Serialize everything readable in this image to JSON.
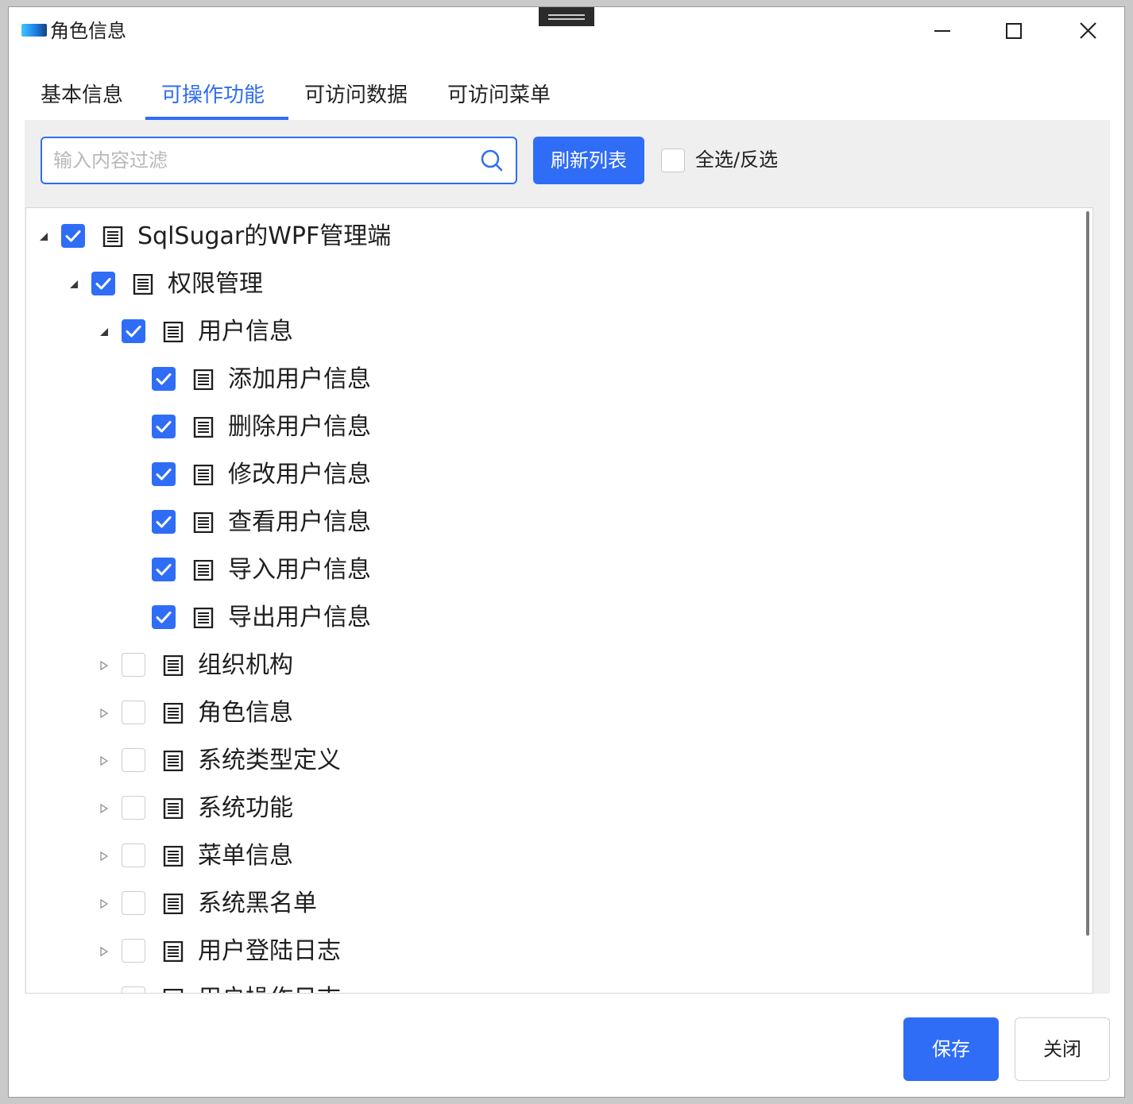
{
  "window": {
    "title": "角色信息",
    "controls": [
      "minimize-icon",
      "maximize-icon",
      "close-icon"
    ]
  },
  "tabs": [
    {
      "label": "基本信息",
      "active": false
    },
    {
      "label": "可操作功能",
      "active": true
    },
    {
      "label": "可访问数据",
      "active": false
    },
    {
      "label": "可访问菜单",
      "active": false
    }
  ],
  "toolbar": {
    "filter_value": "",
    "filter_placeholder": "输入内容过滤",
    "search_icon": "search-icon",
    "refresh_label": "刷新列表",
    "select_all_label": "全选/反选",
    "select_all_checked": false
  },
  "tree": {
    "item_icon": "list-document-icon",
    "nodes": [
      {
        "label": "SqlSugar的WPF管理端",
        "level": 0,
        "checked": true,
        "expander": "expanded"
      },
      {
        "label": "权限管理",
        "level": 1,
        "checked": true,
        "expander": "expanded"
      },
      {
        "label": "用户信息",
        "level": 2,
        "checked": true,
        "expander": "expanded"
      },
      {
        "label": "添加用户信息",
        "level": 3,
        "checked": true,
        "expander": "none"
      },
      {
        "label": "删除用户信息",
        "level": 3,
        "checked": true,
        "expander": "none"
      },
      {
        "label": "修改用户信息",
        "level": 3,
        "checked": true,
        "expander": "none"
      },
      {
        "label": "查看用户信息",
        "level": 3,
        "checked": true,
        "expander": "none"
      },
      {
        "label": "导入用户信息",
        "level": 3,
        "checked": true,
        "expander": "none"
      },
      {
        "label": "导出用户信息",
        "level": 3,
        "checked": true,
        "expander": "none"
      },
      {
        "label": "组织机构",
        "level": 2,
        "checked": false,
        "expander": "collapsed"
      },
      {
        "label": "角色信息",
        "level": 2,
        "checked": false,
        "expander": "collapsed"
      },
      {
        "label": "系统类型定义",
        "level": 2,
        "checked": false,
        "expander": "collapsed"
      },
      {
        "label": "系统功能",
        "level": 2,
        "checked": false,
        "expander": "collapsed"
      },
      {
        "label": "菜单信息",
        "level": 2,
        "checked": false,
        "expander": "collapsed"
      },
      {
        "label": "系统黑名单",
        "level": 2,
        "checked": false,
        "expander": "collapsed"
      },
      {
        "label": "用户登陆日志",
        "level": 2,
        "checked": false,
        "expander": "collapsed"
      },
      {
        "label": "用户操作日志",
        "level": 2,
        "checked": false,
        "expander": "collapsed"
      }
    ]
  },
  "footer": {
    "save_label": "保存",
    "close_label": "关闭"
  },
  "colors": {
    "accent": "#2f6df6",
    "panel_bg": "#efefef",
    "text": "#1f1f1f"
  }
}
